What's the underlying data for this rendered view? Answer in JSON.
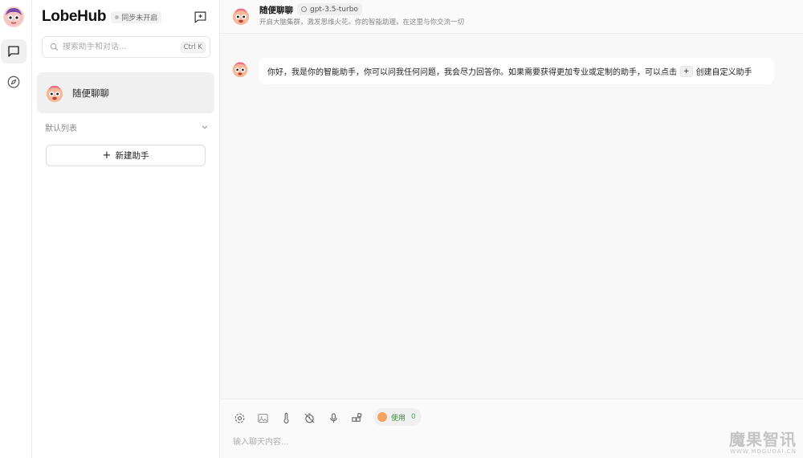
{
  "app": {
    "name": "LobeHub",
    "sync_status": "同步未开启"
  },
  "search": {
    "placeholder": "搜索助手和对话...",
    "shortcut": "Ctrl K"
  },
  "sessions": [
    {
      "title": "随便聊聊"
    }
  ],
  "group": {
    "label": "默认列表"
  },
  "add_assistant": {
    "label": "新建助手"
  },
  "chat": {
    "title": "随便聊聊",
    "model": "gpt-3.5-turbo",
    "description": "开启大脑集群，激发思维火花。你的智能助理，在这里与你交流一切",
    "welcome": {
      "before": "你好，我是你的智能助手，你可以问我任何问题，我会尽力回答你。如果需要获得更加专业或定制的助手，可以点击",
      "plus": "+",
      "after": "创建自定义助手"
    }
  },
  "input": {
    "placeholder": "输入聊天内容...",
    "token_label": "使用",
    "token_count": "0"
  },
  "watermark": {
    "main": "魔果智讯",
    "sub": "WWW.MOGUOAI.CN"
  },
  "icons": {
    "rail": [
      "chat-icon",
      "compass-icon"
    ],
    "toolbar": [
      "settings-icon",
      "image-icon",
      "thermometer-icon",
      "timer-off-icon",
      "microphone-icon",
      "plugin-icon"
    ]
  },
  "colors": {
    "accent": "#3b8a3b",
    "sidebar_active": "#f0f0f0",
    "main_bg": "#f8f8f8"
  }
}
